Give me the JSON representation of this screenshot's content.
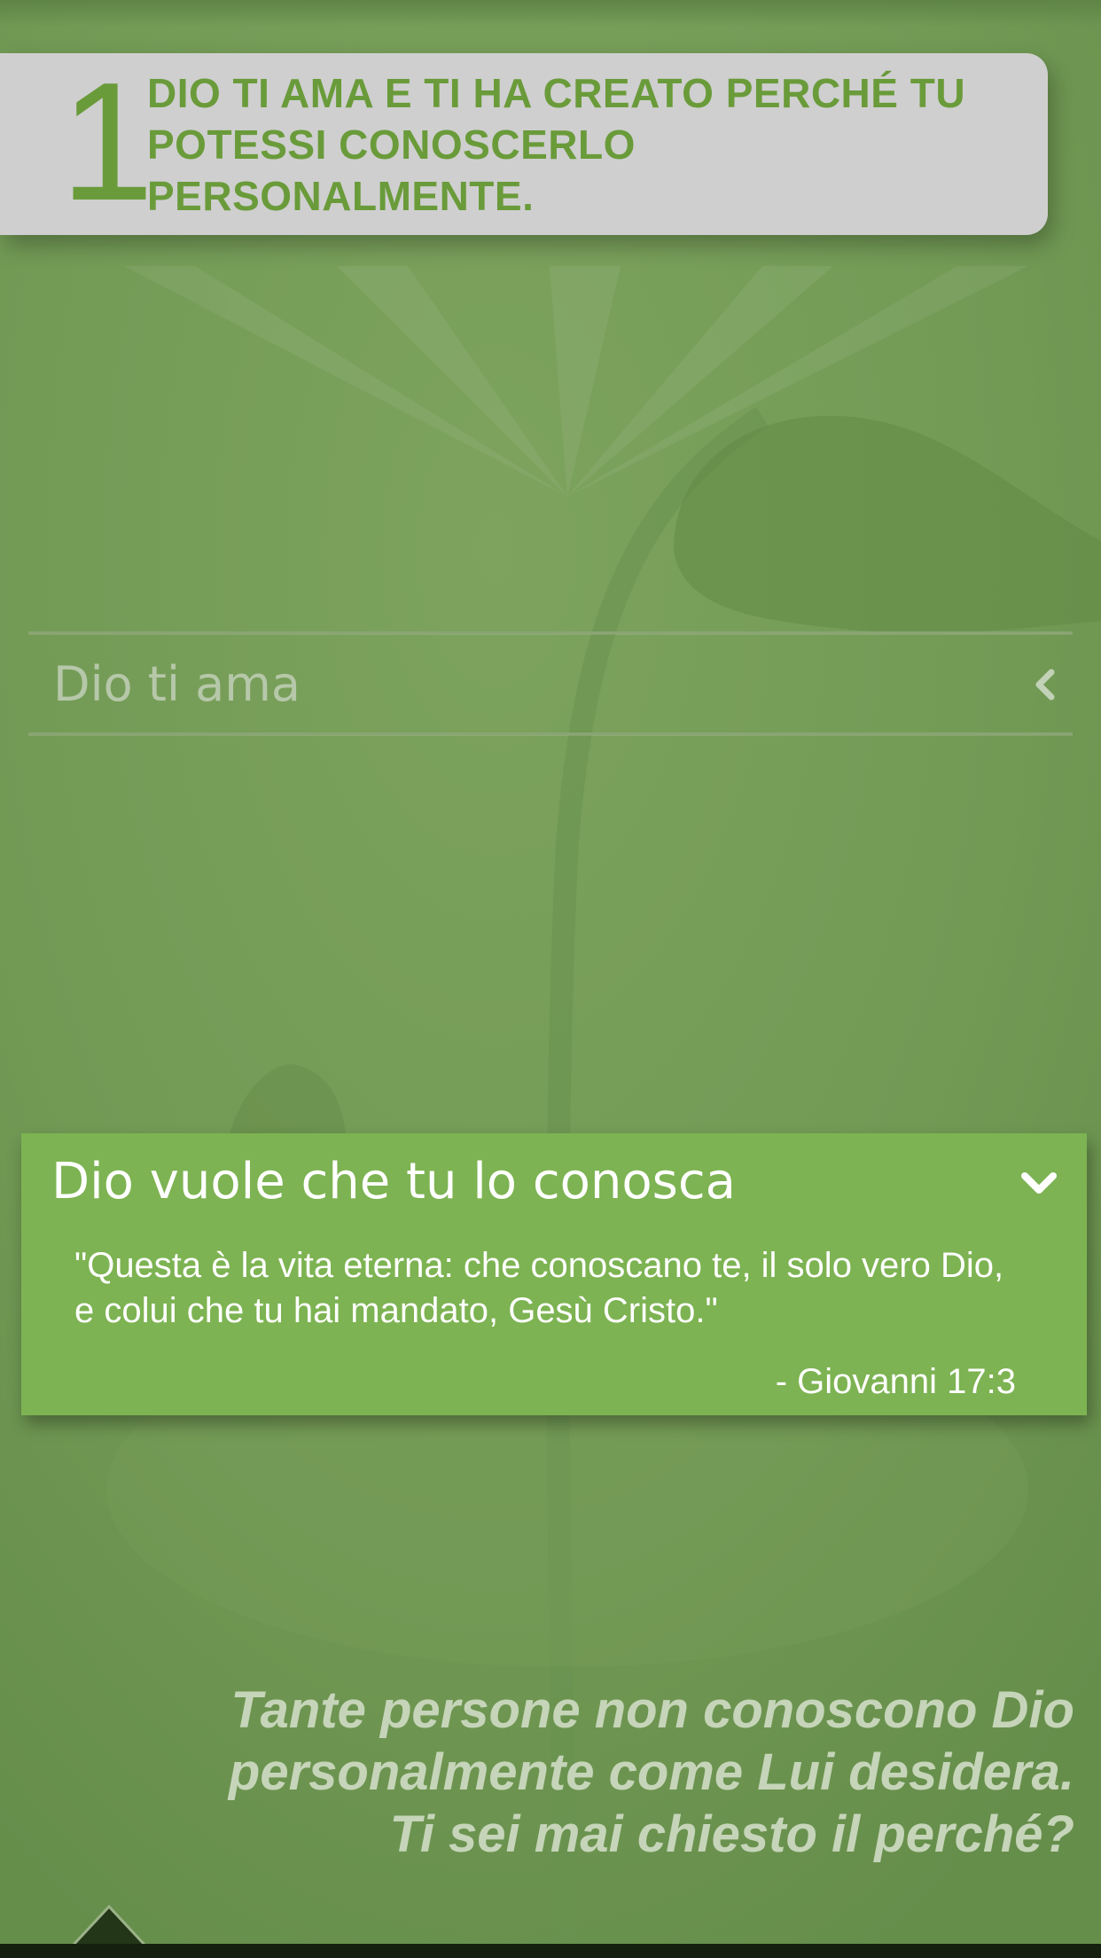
{
  "banner": {
    "number": "1",
    "title": "DIO TI AMA E TI HA CREATO PERCHÉ TU POTESSI CONOSCERLO PERSONALMENTE."
  },
  "accordion": {
    "collapsed_item": {
      "label": "Dio ti ama",
      "icon": "chevron-left-icon"
    },
    "expanded_item": {
      "title": "Dio vuole che tu lo conosca",
      "icon": "chevron-down-icon",
      "quote": "\"Questa è la vita eterna: che conoscano te, il solo vero Dio, e colui che tu hai mandato, Gesù Cristo.\"",
      "reference": "- Giovanni 17:3"
    }
  },
  "teaser": {
    "lines": [
      "Tante persone non conoscono Dio",
      "personalmente come Lui desidera.",
      "Ti sei mai chiesto il perché?"
    ]
  },
  "nav": {
    "up_icon": "up-arrow-icon"
  },
  "colors": {
    "background": "#729a55",
    "banner_bg": "#cfcfcf",
    "accent_green": "#6a9b3a",
    "card_bg": "#7db352"
  }
}
